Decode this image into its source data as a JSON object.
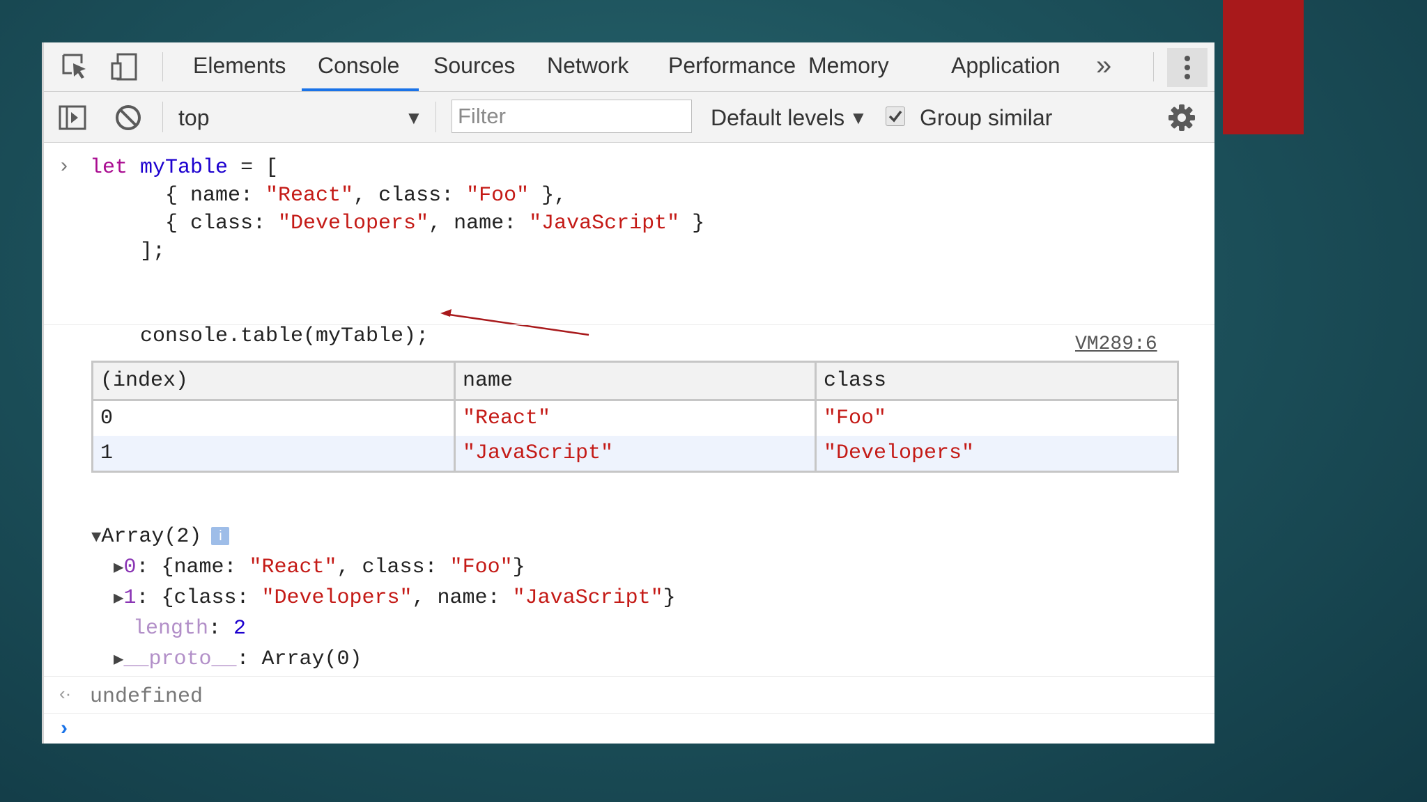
{
  "accent": "#1a73e8",
  "tabs": [
    "Elements",
    "Console",
    "Sources",
    "Network",
    "Performance",
    "Memory",
    "Application"
  ],
  "active_tab": "Console",
  "toolbar": {
    "context": "top",
    "filter_placeholder": "Filter",
    "levels": "Default levels",
    "group_similar": "Group similar",
    "group_similar_checked": true
  },
  "input_code": {
    "let": "let",
    "var_name": "myTable",
    "eq_bracket": " = [",
    "row1_open": "{ name: ",
    "row1_name": "\"React\"",
    "row1_mid": ", class: ",
    "row1_class": "\"Foo\"",
    "row1_close": " },",
    "row2_open": "{ class: ",
    "row2_class": "\"Developers\"",
    "row2_mid": ", name: ",
    "row2_name": "\"JavaScript\"",
    "row2_close": " }",
    "close": "];",
    "call": "console.table(myTable);"
  },
  "source_link": "VM289:6",
  "table": {
    "headers": [
      "(index)",
      "name",
      "class"
    ],
    "rows": [
      [
        "0",
        "\"React\"",
        "\"Foo\""
      ],
      [
        "1",
        "\"JavaScript\"",
        "\"Developers\""
      ]
    ]
  },
  "array_tree": {
    "label": "Array(2)",
    "info": "i",
    "item0_key": "0",
    "item0_a": ": {name: ",
    "item0_name": "\"React\"",
    "item0_b": ", class: ",
    "item0_class": "\"Foo\"",
    "item0_c": "}",
    "item1_key": "1",
    "item1_a": ": {class: ",
    "item1_class": "\"Developers\"",
    "item1_b": ", name: ",
    "item1_name": "\"JavaScript\"",
    "item1_c": "}",
    "length_key": "length",
    "length_sep": ": ",
    "length_val": "2",
    "proto_key": "__proto__",
    "proto_val": ": Array(0)"
  },
  "result": "undefined"
}
